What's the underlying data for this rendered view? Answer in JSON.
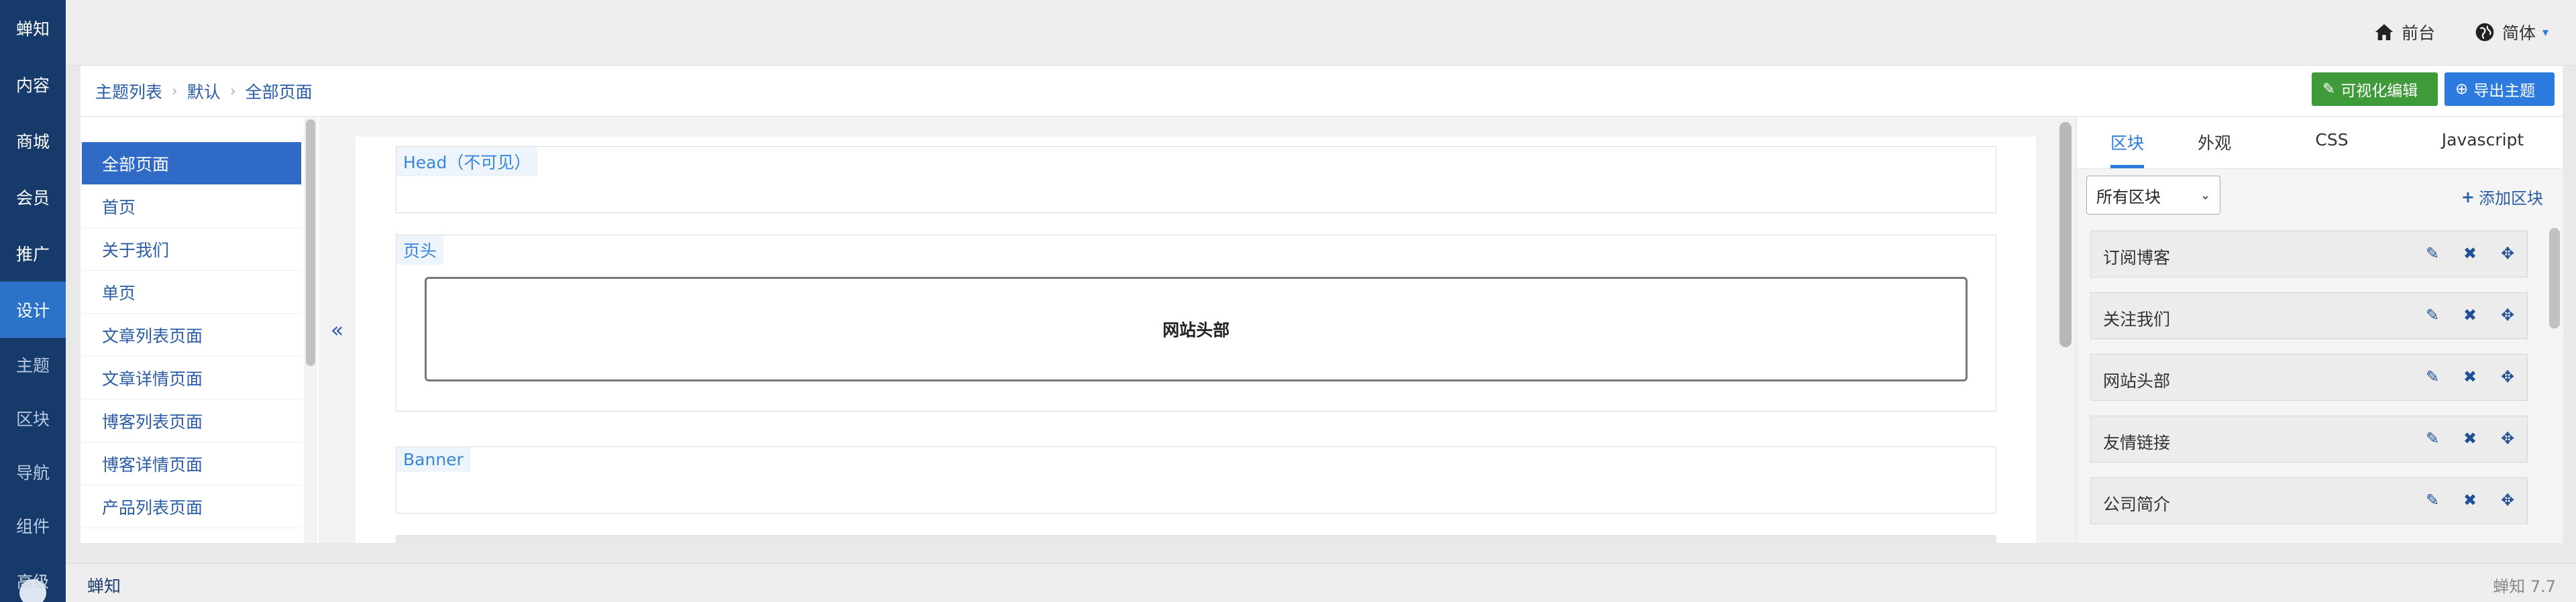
{
  "leftnav": {
    "main_items": [
      "蝉知",
      "内容",
      "商城",
      "会员",
      "推广",
      "设计"
    ],
    "sub_items": [
      "主题",
      "区块",
      "导航",
      "组件",
      "高级"
    ],
    "active": "设计"
  },
  "topbar": {
    "frontend_label": "前台",
    "language_label": "简体"
  },
  "breadcrumb": {
    "items": [
      "主题列表",
      "默认",
      "全部页面"
    ]
  },
  "actions": {
    "visual_edit_label": "可视化编辑",
    "export_theme_label": "导出主题"
  },
  "pagelist": {
    "items": [
      "全部页面",
      "首页",
      "关于我们",
      "单页",
      "文章列表页面",
      "文章详情页面",
      "博客列表页面",
      "博客详情页面",
      "产品列表页面"
    ],
    "active": "全部页面"
  },
  "collapse_glyph": "«",
  "canvas": {
    "head_label": "Head（不可见）",
    "header_label": "页头",
    "site_header_text": "网站头部",
    "banner_label": "Banner"
  },
  "rightpanel": {
    "tabs": [
      "区块",
      "外观",
      "CSS",
      "Javascript"
    ],
    "active_tab": "区块",
    "filter_value": "所有区块",
    "add_block_label": "添加区块",
    "blocks": [
      "订阅博客",
      "关注我们",
      "网站头部",
      "友情链接",
      "公司简介"
    ]
  },
  "footer": {
    "brand": "蝉知",
    "version": "蝉知 7.7"
  },
  "colors": {
    "nav_bg": "#163a6a",
    "nav_active": "#2b72c9",
    "link_blue": "#2a5ca8",
    "visual_btn": "#3f9a3a",
    "export_btn": "#2e7be0"
  }
}
